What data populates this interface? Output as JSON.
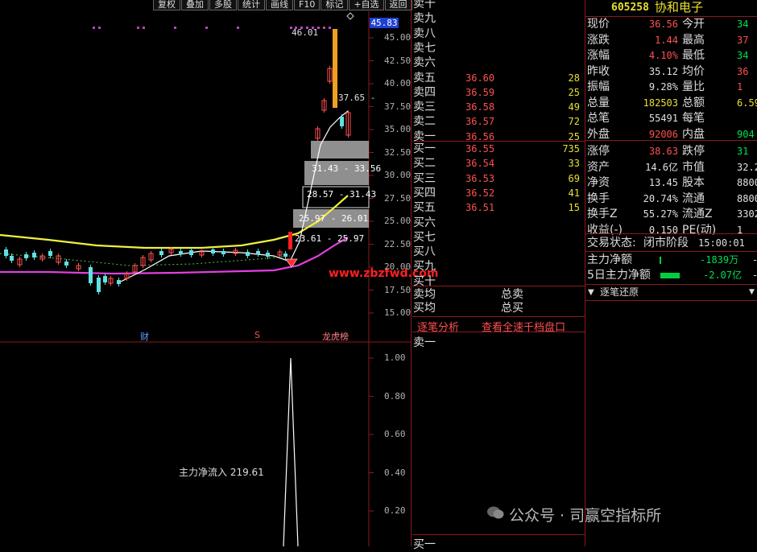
{
  "toolbar": [
    "复权",
    "叠加",
    "多股",
    "统计",
    "画线",
    "F10",
    "标记",
    "+自选",
    "返回"
  ],
  "chart": {
    "price_axis": [
      "45.00",
      "42.50",
      "40.00",
      "37.50",
      "35.00",
      "32.50",
      "30.00",
      "27.50",
      "25.00",
      "22.50",
      "20.00",
      "17.50",
      "15.00"
    ],
    "current_price_tag": "45.83",
    "high_label": "46.01",
    "label_3765": "37.65 -",
    "ranges": [
      "31.43 - 33.56",
      "28.57 - 31.43",
      "25.97 - 26.01",
      "23.61 - 25.97"
    ],
    "watermark": "www.zbzfwd.com",
    "markers": {
      "cai": "财",
      "s": "S",
      "longhu": "龙虎榜"
    }
  },
  "indicator": {
    "axis": [
      "1.00",
      "0.80",
      "0.60",
      "0.40",
      "0.20"
    ],
    "label": "主力净流入 219.61"
  },
  "book": {
    "sell": [
      {
        "label": "卖十",
        "price": "",
        "vol": ""
      },
      {
        "label": "卖九",
        "price": "",
        "vol": ""
      },
      {
        "label": "卖八",
        "price": "",
        "vol": ""
      },
      {
        "label": "卖七",
        "price": "",
        "vol": ""
      },
      {
        "label": "卖六",
        "price": "",
        "vol": ""
      },
      {
        "label": "卖五",
        "price": "36.60",
        "vol": "28"
      },
      {
        "label": "卖四",
        "price": "36.59",
        "vol": "25"
      },
      {
        "label": "卖三",
        "price": "36.58",
        "vol": "49"
      },
      {
        "label": "卖二",
        "price": "36.57",
        "vol": "72"
      },
      {
        "label": "卖一",
        "price": "36.56",
        "vol": "25"
      }
    ],
    "buy": [
      {
        "label": "买一",
        "price": "36.55",
        "vol": "735"
      },
      {
        "label": "买二",
        "price": "36.54",
        "vol": "33"
      },
      {
        "label": "买三",
        "price": "36.53",
        "vol": "69"
      },
      {
        "label": "买四",
        "price": "36.52",
        "vol": "41"
      },
      {
        "label": "买五",
        "price": "36.51",
        "vol": "15"
      },
      {
        "label": "买六",
        "price": "",
        "vol": ""
      },
      {
        "label": "买七",
        "price": "",
        "vol": ""
      },
      {
        "label": "买八",
        "price": "",
        "vol": ""
      },
      {
        "label": "买九",
        "price": "",
        "vol": ""
      },
      {
        "label": "买十",
        "price": "",
        "vol": ""
      }
    ],
    "sell_avg": "卖均",
    "buy_avg": "买均",
    "total_sell": "总卖",
    "total_buy": "总买",
    "tab_analysis": "逐笔分析",
    "tab_full": "查看全速千档盘口",
    "detail_label": "卖一",
    "bottom_label": "买一"
  },
  "quote": {
    "code": "605258",
    "name": "协和电子",
    "rows": [
      {
        "k1": "现价",
        "v1": "36.56",
        "c1": "red",
        "k2": "今开",
        "v2": "34",
        "c2": "grn"
      },
      {
        "k1": "涨跌",
        "v1": "1.44",
        "c1": "red",
        "k2": "最高",
        "v2": "37",
        "c2": "red"
      },
      {
        "k1": "涨幅",
        "v1": "4.10%",
        "c1": "red",
        "k2": "最低",
        "v2": "34",
        "c2": "grn"
      },
      {
        "k1": "昨收",
        "v1": "35.12",
        "c1": "wht",
        "k2": "均价",
        "v2": "36",
        "c2": "red"
      },
      {
        "k1": "振幅",
        "v1": "9.28%",
        "c1": "wht",
        "k2": "量比",
        "v2": "1",
        "c2": "red"
      },
      {
        "k1": "总量",
        "v1": "182503",
        "c1": "yel",
        "k2": "总额",
        "v2": "6.59",
        "c2": "yel"
      },
      {
        "k1": "总笔",
        "v1": "55491",
        "c1": "wht",
        "k2": "每笔",
        "v2": "",
        "c2": "wht"
      },
      {
        "k1": "外盘",
        "v1": "92006",
        "c1": "red",
        "k2": "内盘",
        "v2": "904",
        "c2": "grn"
      },
      {
        "k1": "涨停",
        "v1": "38.63",
        "c1": "red",
        "k2": "跌停",
        "v2": "31",
        "c2": "grn"
      },
      {
        "k1": "资产",
        "v1": "14.6亿",
        "c1": "wht",
        "k2": "市值",
        "v2": "32.2",
        "c2": "wht"
      },
      {
        "k1": "净资",
        "v1": "13.45",
        "c1": "wht",
        "k2": "股本",
        "v2": "8800",
        "c2": "wht"
      },
      {
        "k1": "换手",
        "v1": "20.74%",
        "c1": "wht",
        "k2": "流通",
        "v2": "8800",
        "c2": "wht"
      },
      {
        "k1": "换手Z",
        "v1": "55.27%",
        "c1": "wht",
        "k2": "流通Z",
        "v2": "3302",
        "c2": "wht"
      },
      {
        "k1": "收益(-)",
        "v1": "0.150",
        "c1": "wht",
        "k2": "PE(动)",
        "v2": "1",
        "c2": "wht"
      }
    ],
    "status_label": "交易状态:",
    "status_value": "闭市阶段",
    "status_time": "15:00:01",
    "net_label": "主力净额",
    "net_value": "-1839万",
    "net_extra": "-",
    "net5_label": "5日主力净额",
    "net5_value": "-2.07亿",
    "net5_extra": "-",
    "tick_title": "逐笔还原"
  },
  "watermark_account": "公众号 · 司赢空指标所",
  "colors": {
    "up": "#ff5050",
    "down": "#00e0e0",
    "ma_yellow": "#f0f040",
    "band_magenta": "#e040e0",
    "bar_orange": "#f0a020"
  }
}
